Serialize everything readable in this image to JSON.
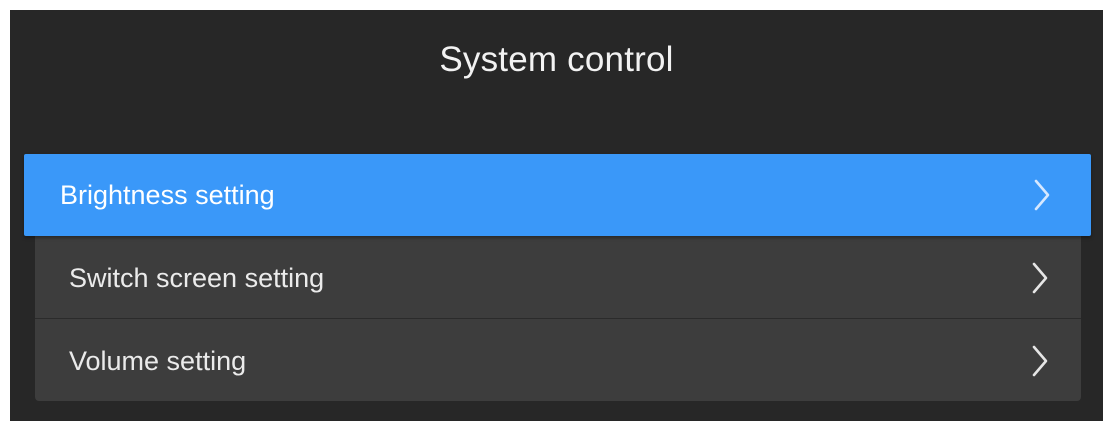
{
  "header": {
    "title": "System control"
  },
  "menu": {
    "items": [
      {
        "label": "Brightness setting",
        "selected": true,
        "icon": "chevron-right-icon"
      },
      {
        "label": "Switch screen setting",
        "selected": false,
        "icon": "chevron-right-icon"
      },
      {
        "label": "Volume setting",
        "selected": false,
        "icon": "chevron-right-icon"
      }
    ]
  },
  "colors": {
    "background": "#272727",
    "selected_item": "#3a98f9",
    "list_background": "#3d3d3d",
    "text": "#ebebeb"
  }
}
